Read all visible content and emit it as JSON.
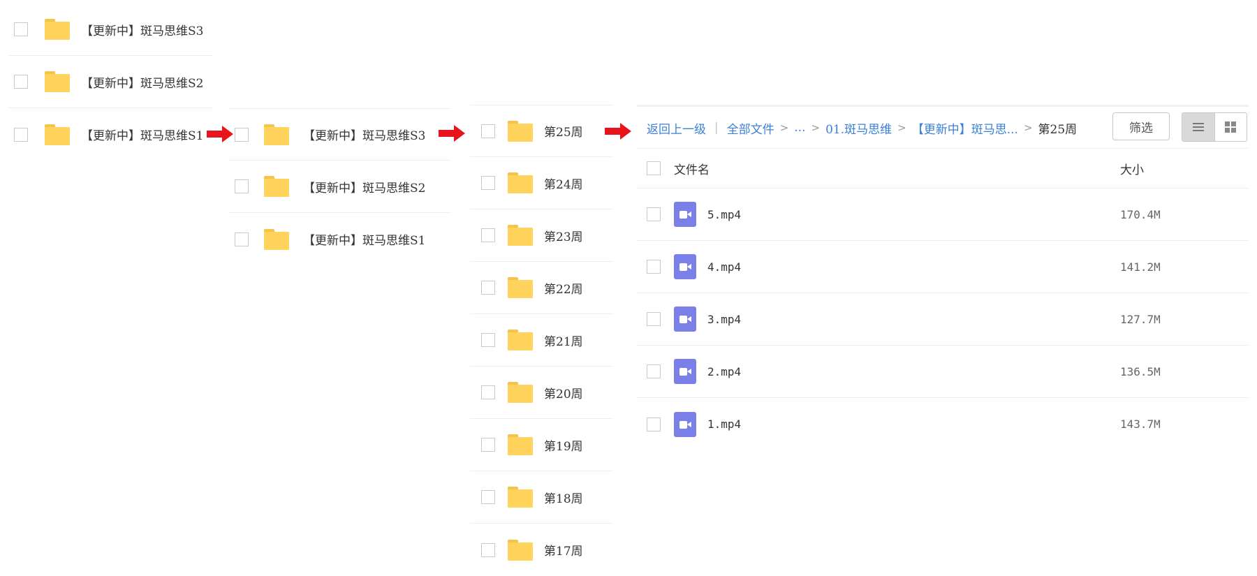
{
  "col1": {
    "items": [
      {
        "label": "【更新中】斑马思维S3"
      },
      {
        "label": "【更新中】斑马思维S2"
      },
      {
        "label": "【更新中】斑马思维S1"
      }
    ]
  },
  "col2": {
    "items": [
      {
        "label": "【更新中】斑马思维S3"
      },
      {
        "label": "【更新中】斑马思维S2"
      },
      {
        "label": "【更新中】斑马思维S1"
      }
    ]
  },
  "col3": {
    "items": [
      {
        "label": "第25周"
      },
      {
        "label": "第24周"
      },
      {
        "label": "第23周"
      },
      {
        "label": "第22周"
      },
      {
        "label": "第21周"
      },
      {
        "label": "第20周"
      },
      {
        "label": "第19周"
      },
      {
        "label": "第18周"
      },
      {
        "label": "第17周"
      }
    ]
  },
  "panel": {
    "back_label": "返回上一级",
    "breadcrumb": {
      "all_files": "全部文件",
      "ellipsis": "...",
      "level1": "01.斑马思维",
      "level2": "【更新中】斑马思...",
      "current": "第25周"
    },
    "filter_label": "筛选",
    "header": {
      "name": "文件名",
      "size": "大小"
    },
    "files": [
      {
        "name": "5.mp4",
        "size": "170.4M"
      },
      {
        "name": "4.mp4",
        "size": "141.2M"
      },
      {
        "name": "3.mp4",
        "size": "127.7M"
      },
      {
        "name": "2.mp4",
        "size": "136.5M"
      },
      {
        "name": "1.mp4",
        "size": "143.7M"
      }
    ]
  },
  "colors": {
    "accent_link": "#3b7fd9",
    "folder_yellow": "#ffd35c",
    "video_purple": "#7b7fe8",
    "arrow_red": "#e8141c"
  },
  "icons": {
    "folder": "folder-icon",
    "video": "video-file-icon",
    "arrow": "red-arrow-icon",
    "list_view": "list-view-icon",
    "grid_view": "grid-view-icon"
  }
}
